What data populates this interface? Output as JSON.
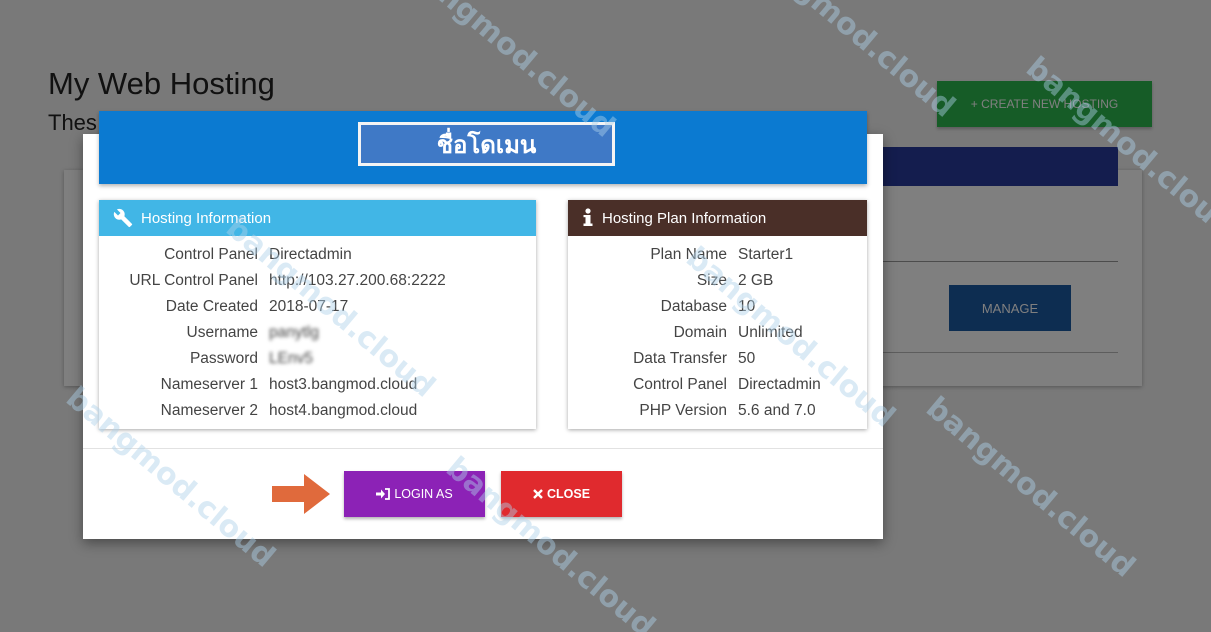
{
  "page": {
    "title": "My Web Hosting",
    "subtitle": "Thes",
    "create_button": "+ CREATE NEW HOSTING",
    "manage_button": "MANAGE"
  },
  "modal": {
    "title": "ชื่อโดเมน",
    "hosting_info": {
      "heading": "Hosting Information",
      "icon": "wrench-icon",
      "rows": [
        {
          "label": "Control Panel",
          "value": "Directadmin"
        },
        {
          "label": "URL Control Panel",
          "value": "http://103.27.200.68:2222"
        },
        {
          "label": "Date Created",
          "value": "2018-07-17"
        },
        {
          "label": "Username",
          "value": "panytlg"
        },
        {
          "label": "Password",
          "value": "LEnv5"
        },
        {
          "label": "Nameserver 1",
          "value": "host3.bangmod.cloud"
        },
        {
          "label": "Nameserver 2",
          "value": "host4.bangmod.cloud"
        }
      ]
    },
    "plan_info": {
      "heading": "Hosting Plan Information",
      "icon": "info-icon",
      "rows": [
        {
          "label": "Plan Name",
          "value": "Starter1"
        },
        {
          "label": "Size",
          "value": "2 GB"
        },
        {
          "label": "Database",
          "value": "10"
        },
        {
          "label": "Domain",
          "value": "Unlimited"
        },
        {
          "label": "Data Transfer",
          "value": "50"
        },
        {
          "label": "Control Panel",
          "value": "Directadmin"
        },
        {
          "label": "PHP Version",
          "value": "5.6 and 7.0"
        }
      ]
    },
    "login_button": "LOGIN AS",
    "close_button": "CLOSE"
  },
  "watermark": "bangmod.cloud",
  "colors": {
    "modal_header": "#0b7ad1",
    "hosting_head": "#41b6e6",
    "plan_head": "#4a2f28",
    "login": "#8c22b6",
    "close": "#e02a2e",
    "create": "#2db84e",
    "manage": "#1b5aa3",
    "arrow": "#e06a3c"
  }
}
